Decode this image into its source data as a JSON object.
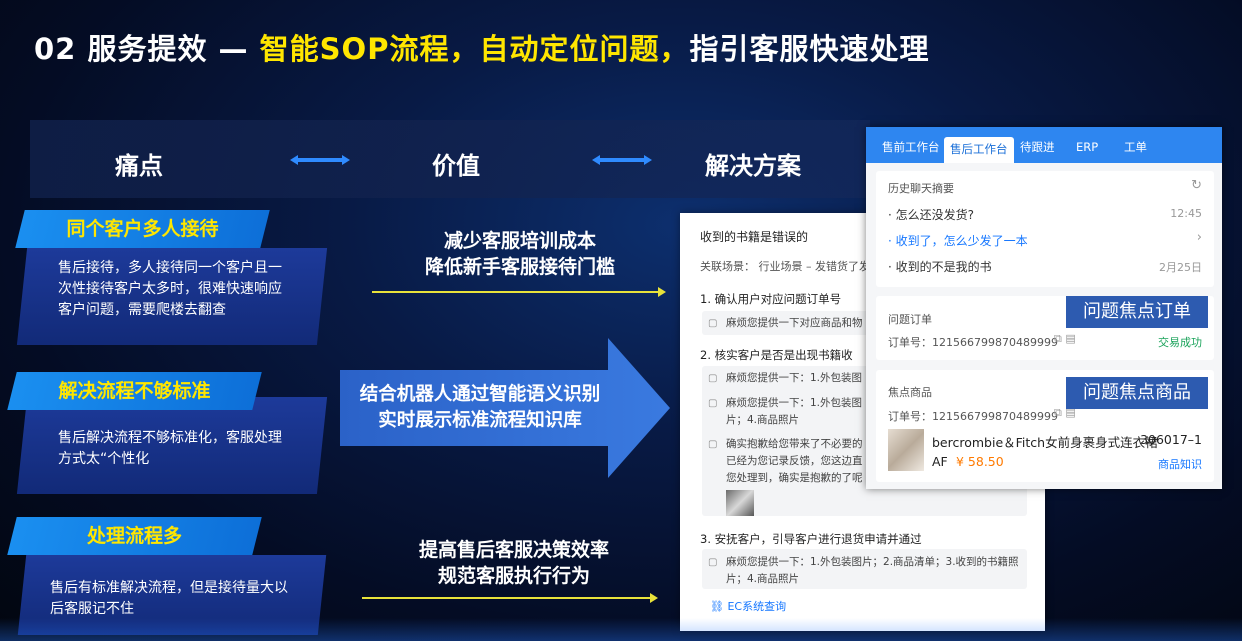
{
  "title": {
    "prefix": "02  服务提效 — ",
    "highlight": "智能SOP流程，自动定位问题，",
    "suffix": "指引客服快速处理"
  },
  "columns": {
    "pain": "痛点",
    "value": "价值",
    "solution": "解决方案"
  },
  "pains": [
    {
      "tag": "同个客户多人接待",
      "text": "售后接待，多人接待同一个客户且一次性接待客户太多时，很难快速响应客户问题，需要爬楼去翻查"
    },
    {
      "tag": "解决流程不够标准",
      "text": "售后解决流程不够标准化，客服处理方式太“个性化"
    },
    {
      "tag": "处理流程多",
      "text": "售后有标准解决流程，但是接待量大以后客服记不住"
    }
  ],
  "values": {
    "v1_line1": "减少客服培训成本",
    "v1_line2": "降低新手客服接待门槛",
    "v2_line1": "结合机器人通过智能语义识别",
    "v2_line2": "实时展示标准流程知识库",
    "v3_line1": "提高售后客服决策效率",
    "v3_line2": "规范客服执行行为"
  },
  "doc": {
    "title": "收到的书籍是错误的",
    "scene": "关联场景：   行业场景 – 发错货了发",
    "step1": "1. 确认用户对应问题订单号",
    "step1_line": "麻烦您提供一下对应商品和物",
    "step2": "2. 核实客户是否是出现书籍收",
    "step2_a1": "麻烦您提供一下：1.外包装图",
    "step2_a2": "麻烦您提供一下：1.外包装图",
    "step2_a2b": "片；4.商品照片",
    "step2_b1": "确实抱歉给您带来了不必要的",
    "step2_b2": "已经为您记录反馈，您这边直",
    "step2_b3": "您处理到，确实是抱歉的了呢",
    "step3": "3. 安抚客户，引导客户进行退货申请并通过",
    "step3_l1": "麻烦您提供一下：1.外包装图片；2.商品清单；3.收到的书籍照",
    "step3_l2": "片；4.商品照片",
    "link": "EC系统查询"
  },
  "app": {
    "tabs": [
      "售前工作台",
      "售后工作台",
      "待跟进",
      "ERP",
      "工单"
    ],
    "active_tab": "售后工作台",
    "history_title": "历史聊天摘要",
    "history": [
      {
        "text": "· 怎么还没发货?",
        "time": "12:45"
      },
      {
        "text": "· 收到了，怎么少发了一本",
        "time": ""
      },
      {
        "text": "· 收到的不是我的书",
        "time": "2月25日"
      }
    ],
    "order_title": "问题订单",
    "order_no": "订单号：121566799870489999",
    "order_status": "交易成功",
    "focus_title": "焦点商品",
    "focus_order_no": "订单号：121566799870489999",
    "product_name": "bercrombie＆Fitch女前身裹身式连衣裙",
    "product_code": "306017–1",
    "product_brand": "AF",
    "product_price": "¥ 58.50",
    "product_link": "商品知识",
    "tag_order": "问题焦点订单",
    "tag_product": "问题焦点商品"
  }
}
